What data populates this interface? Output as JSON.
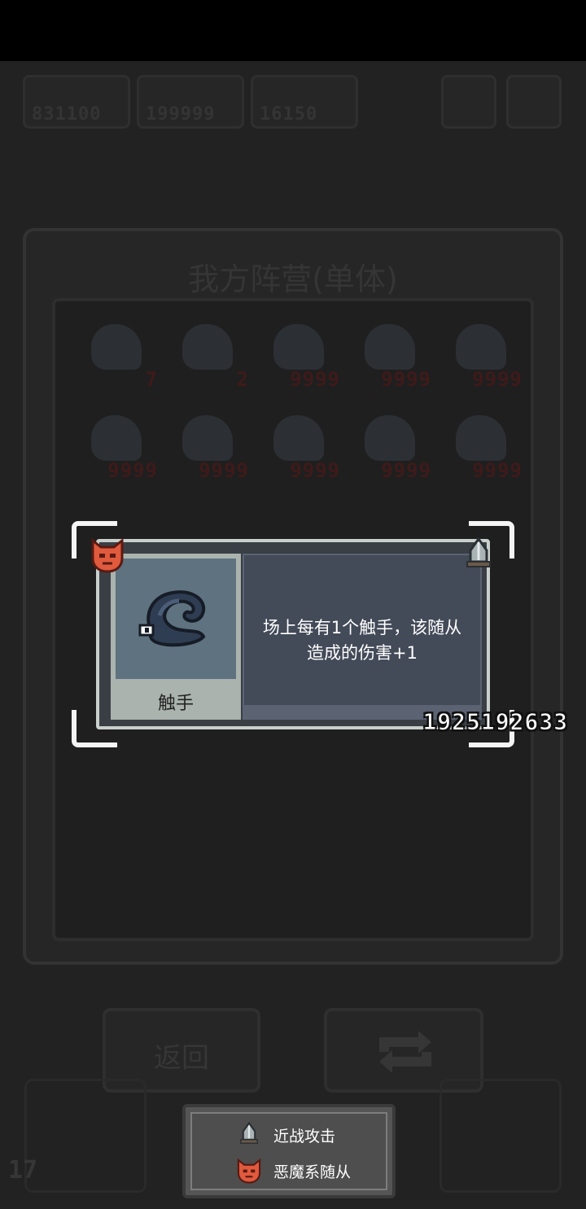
{
  "resources": [
    {
      "icon": "resource-icon-1",
      "value": "831100"
    },
    {
      "icon": "resource-icon-2",
      "value": "199999"
    },
    {
      "icon": "resource-icon-3",
      "value": "16150"
    }
  ],
  "panel": {
    "title": "我方阵营(单体)"
  },
  "roster_counts": [
    "7",
    "2",
    "9999",
    "9999",
    "9999",
    "9999",
    "9999",
    "9999",
    "9999",
    "9999"
  ],
  "card": {
    "name": "触手",
    "description_line1": "场上每有1个触手，该随从",
    "description_line2": "造成的伤害+1",
    "id": "1925192633",
    "type_tag": "demon-mask-icon",
    "attack_tag": "melee-shield-icon"
  },
  "buttons": {
    "back_label": "返回"
  },
  "legend": {
    "melee_label": "近战攻击",
    "demon_label": "恶魔系随从"
  },
  "level": "17",
  "colors": {
    "demon": "#e05a3e",
    "card_frame": "#c9d0cc",
    "card_body": "#434a58"
  }
}
